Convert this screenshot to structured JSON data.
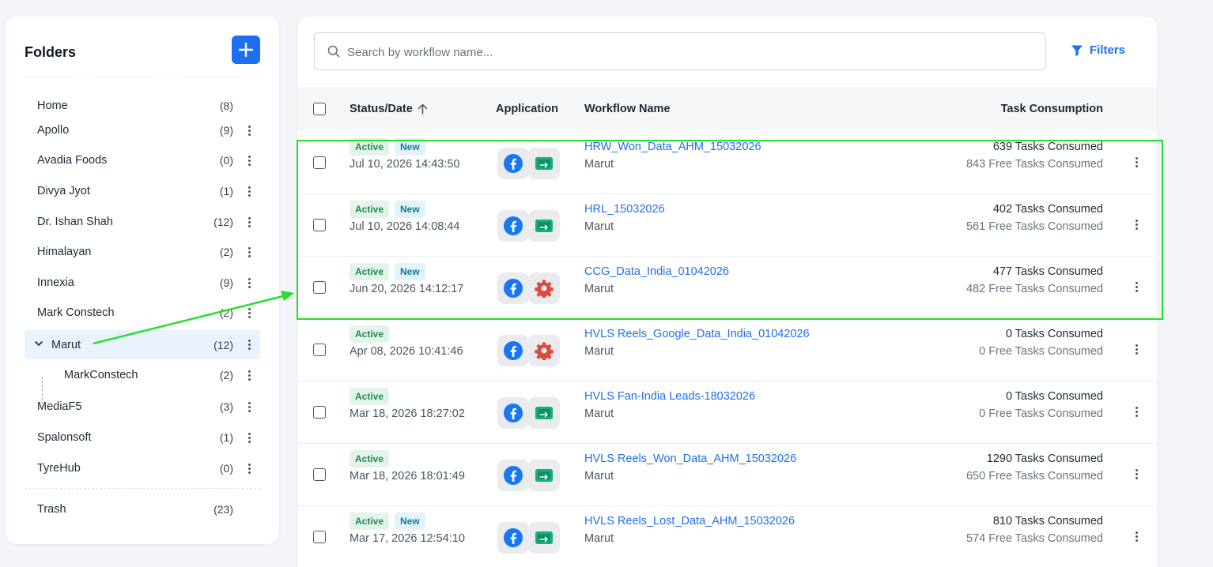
{
  "sidebar": {
    "title": "Folders",
    "add_icon": "plus-icon",
    "folders": [
      {
        "name": "Home",
        "count": "(8)",
        "menu": false
      },
      {
        "name": "Apollo",
        "count": "(9)",
        "menu": true
      },
      {
        "name": "Avadia Foods",
        "count": "(0)",
        "menu": true
      },
      {
        "name": "Divya Jyot",
        "count": "(1)",
        "menu": true
      },
      {
        "name": "Dr. Ishan Shah",
        "count": "(12)",
        "menu": true
      },
      {
        "name": "Himalayan",
        "count": "(2)",
        "menu": true
      },
      {
        "name": "Innexia",
        "count": "(9)",
        "menu": true
      },
      {
        "name": "Mark Constech",
        "count": "(2)",
        "menu": true
      },
      {
        "name": "Marut",
        "count": "(12)",
        "menu": true,
        "selected": true,
        "expanded": true
      },
      {
        "name": "MarkConstech",
        "count": "(2)",
        "menu": true,
        "child": true
      },
      {
        "name": "MediaF5",
        "count": "(3)",
        "menu": true
      },
      {
        "name": "Spalonsoft",
        "count": "(1)",
        "menu": true
      },
      {
        "name": "TyreHub",
        "count": "(0)",
        "menu": true
      }
    ],
    "trash": {
      "name": "Trash",
      "count": "(23)"
    }
  },
  "search": {
    "placeholder": "Search by workflow name...",
    "value": ""
  },
  "filters": {
    "label": "Filters",
    "icon": "funnel-icon"
  },
  "table": {
    "headers": {
      "status_date": "Status/Date",
      "application": "Application",
      "workflow_name": "Workflow Name",
      "task_consumption": "Task Consumption"
    },
    "rows": [
      {
        "status": "Active",
        "is_new": true,
        "new_label": "New",
        "date": "Jul 10, 2026 14:43:50",
        "apps": [
          "facebook-icon",
          "sheets-icon"
        ],
        "name": "HRW_Won_Data_AHM_15032026",
        "folder": "Marut",
        "tasks": "639 Tasks Consumed",
        "free": "843 Free Tasks Consumed"
      },
      {
        "status": "Active",
        "is_new": true,
        "new_label": "New",
        "date": "Jul 10, 2026 14:08:44",
        "apps": [
          "facebook-icon",
          "sheets-icon"
        ],
        "name": "HRL_15032026",
        "folder": "Marut",
        "tasks": "402 Tasks Consumed",
        "free": "561 Free Tasks Consumed"
      },
      {
        "status": "Active",
        "is_new": true,
        "new_label": "New",
        "date": "Jun 20, 2026 14:12:17",
        "apps": [
          "facebook-icon",
          "gear-icon"
        ],
        "name": "CCG_Data_India_01042026",
        "folder": "Marut",
        "tasks": "477 Tasks Consumed",
        "free": "482 Free Tasks Consumed"
      },
      {
        "status": "Active",
        "is_new": false,
        "new_label": "",
        "date": "Apr 08, 2026 10:41:46",
        "apps": [
          "facebook-icon",
          "gear-icon"
        ],
        "name": "HVLS Reels_Google_Data_India_01042026",
        "folder": "Marut",
        "tasks": "0 Tasks Consumed",
        "free": "0 Free Tasks Consumed"
      },
      {
        "status": "Active",
        "is_new": false,
        "new_label": "",
        "date": "Mar 18, 2026 18:27:02",
        "apps": [
          "facebook-icon",
          "sheets-icon"
        ],
        "name": "HVLS Fan-India Leads-18032026",
        "folder": "Marut",
        "tasks": "0 Tasks Consumed",
        "free": "0 Free Tasks Consumed"
      },
      {
        "status": "Active",
        "is_new": false,
        "new_label": "",
        "date": "Mar 18, 2026 18:01:49",
        "apps": [
          "facebook-icon",
          "sheets-icon"
        ],
        "name": "HVLS Reels_Won_Data_AHM_15032026",
        "folder": "Marut",
        "tasks": "1290 Tasks Consumed",
        "free": "650 Free Tasks Consumed"
      },
      {
        "status": "Active",
        "is_new": true,
        "new_label": "New",
        "date": "Mar 17, 2026 12:54:10",
        "apps": [
          "facebook-icon",
          "sheets-icon"
        ],
        "name": "HVLS Reels_Lost_Data_AHM_15032026",
        "folder": "Marut",
        "tasks": "810 Tasks Consumed",
        "free": "574 Free Tasks Consumed"
      }
    ]
  },
  "colors": {
    "accent": "#1e6ff0",
    "highlight": "#22e02a",
    "active_badge": "#1f8a49",
    "new_badge": "#117a9c"
  }
}
